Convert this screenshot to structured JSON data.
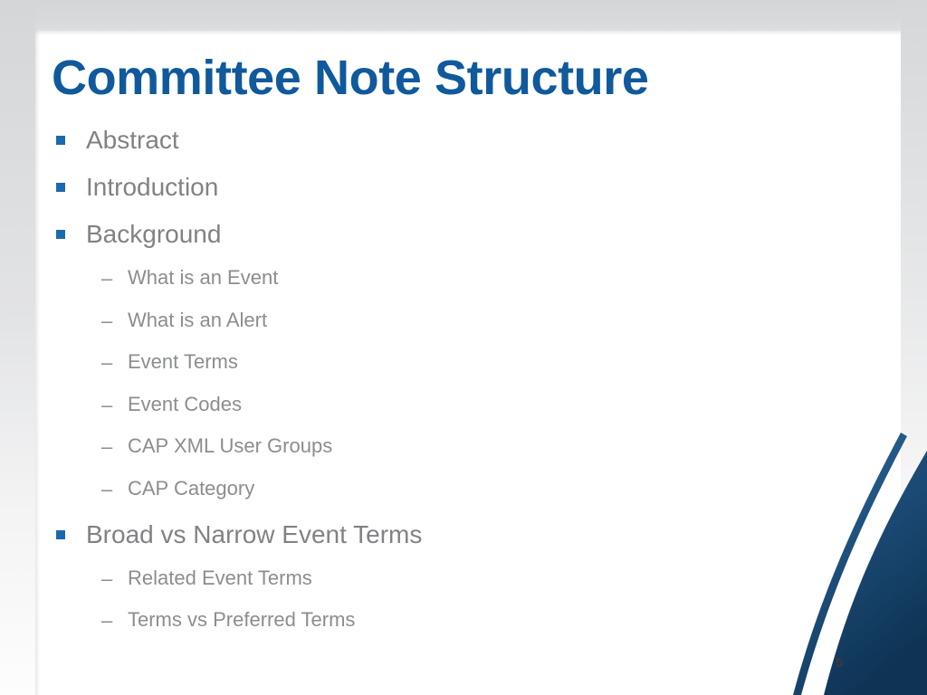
{
  "slide": {
    "title": "Committee Note Structure",
    "page_number": "5",
    "colors": {
      "title_blue": "#10599c",
      "bullet_square_blue": "#1b6aad",
      "body_gray": "#808285",
      "sub_body_gray": "#8b8d8f",
      "swoosh_navy": "#123a5e",
      "swoosh_line_blue": "#1f5c8f",
      "frame_gray": "#d4d6d8",
      "panel_white": "#ffffff",
      "page_number_gray": "#3e3a36"
    },
    "decoration": {
      "corner_swoosh_name": "corner-swoosh-decoration"
    }
  },
  "outline": [
    {
      "level": 1,
      "marker": "square-bullet",
      "text": "Abstract"
    },
    {
      "level": 1,
      "marker": "square-bullet",
      "text": "Introduction"
    },
    {
      "level": 1,
      "marker": "square-bullet",
      "text": "Background"
    },
    {
      "level": 2,
      "marker": "–",
      "text": "What is an Event"
    },
    {
      "level": 2,
      "marker": "–",
      "text": "What is an Alert"
    },
    {
      "level": 2,
      "marker": "–",
      "text": "Event Terms"
    },
    {
      "level": 2,
      "marker": "–",
      "text": "Event Codes"
    },
    {
      "level": 2,
      "marker": "–",
      "text": "CAP XML User Groups"
    },
    {
      "level": 2,
      "marker": "–",
      "text": "CAP Category"
    },
    {
      "level": 1,
      "marker": "square-bullet",
      "text": "Broad vs Narrow Event Terms"
    },
    {
      "level": 2,
      "marker": "–",
      "text": "Related Event Terms"
    },
    {
      "level": 2,
      "marker": "–",
      "text": "Terms vs Preferred Terms"
    }
  ]
}
